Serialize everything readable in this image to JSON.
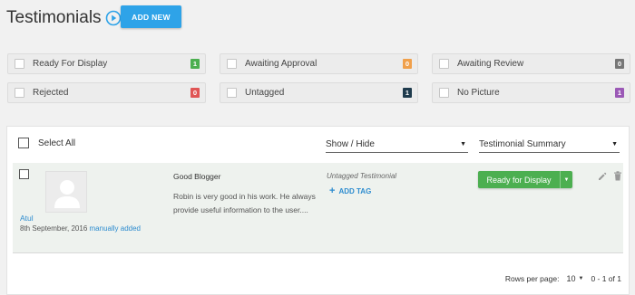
{
  "header": {
    "title": "Testimonials",
    "add_new_label": "ADD NEW"
  },
  "filters": [
    {
      "label": "Ready For Display",
      "count": "1",
      "color": "#4caf50"
    },
    {
      "label": "Awaiting Approval",
      "count": "0",
      "color": "#f0a04b"
    },
    {
      "label": "Awaiting Review",
      "count": "0",
      "color": "#777777"
    },
    {
      "label": "Rejected",
      "count": "0",
      "color": "#e05555"
    },
    {
      "label": "Untagged",
      "count": "1",
      "color": "#1f3b4d"
    },
    {
      "label": "No Picture",
      "count": "1",
      "color": "#9b59b6"
    }
  ],
  "toolbar": {
    "select_all_label": "Select All",
    "show_hide": "Show / Hide",
    "view": "Testimonial Summary"
  },
  "testimonial": {
    "author": "Atul",
    "date": "8th September, 2016",
    "source": "manually added",
    "title": "Good Blogger",
    "body": "Robin is very good in his work. He always provide useful information to the user....",
    "tag_status": "Untagged Testimonial",
    "add_tag_label": "ADD TAG",
    "status_label": "Ready for Display"
  },
  "pagination": {
    "rows_per_page_label": "Rows per page:",
    "rows_per_page": "10",
    "range": "0 - 1 of 1"
  },
  "colors": {
    "accent": "#2ea3e8",
    "status_green": "#4caf50",
    "link": "#2d8ccf"
  }
}
